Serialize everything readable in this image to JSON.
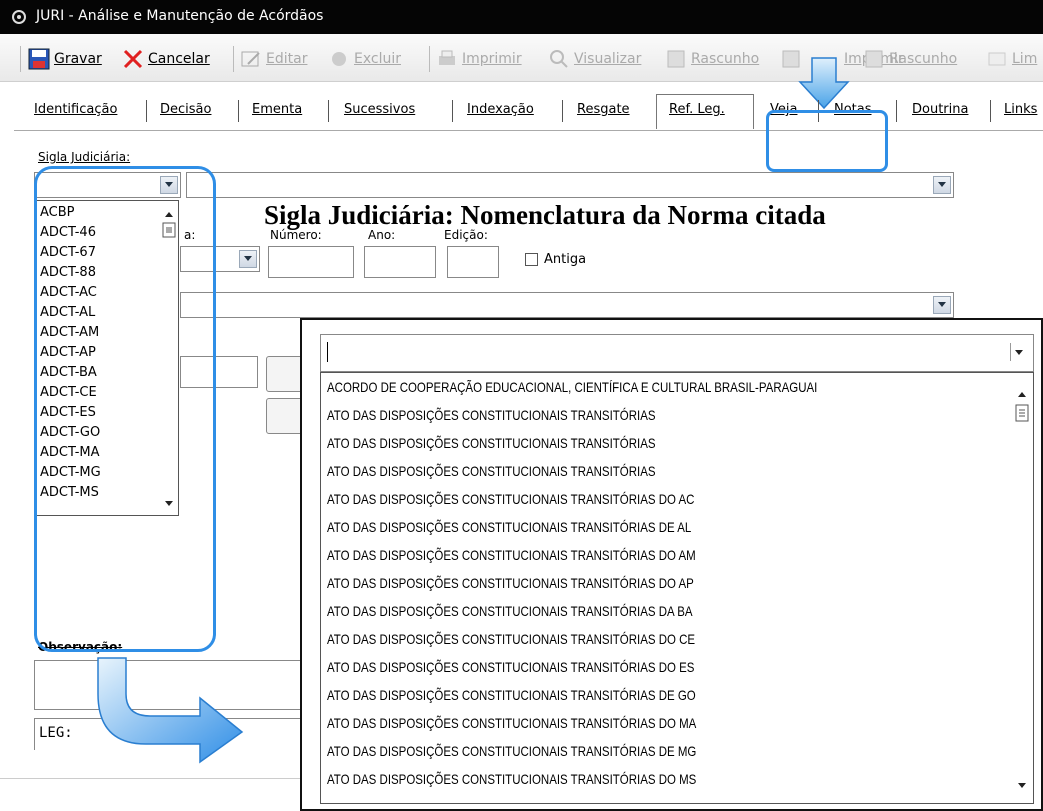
{
  "window": {
    "title": "JURI - Análise e Manutenção de Acórdãos"
  },
  "toolbar": {
    "gravar": "Gravar",
    "cancelar": "Cancelar",
    "editar": "Editar",
    "excluir": "Excluir",
    "imprimir": "Imprimir",
    "visualizar": "Visualizar",
    "rascunho1": "Rascunho",
    "imprimir_partial": "Imprimir",
    "rascunho2": "Rascunho",
    "limpar": "Lim"
  },
  "tabs": [
    "Identificação",
    "Decisão",
    "Ementa",
    "Sucessivos",
    "Indexação",
    "Resgate",
    "Ref. Leg.",
    "Veja",
    "Notas",
    "Doutrina",
    "Links"
  ],
  "form": {
    "sigla_label": "Sigla Judiciária:",
    "numero_label": "Número:",
    "ano_label": "Ano:",
    "edicao_label": "Edição:",
    "norma_label": "a:",
    "antiga_label": "Antiga",
    "observacao_label": "Observação:",
    "leg_text": "LEG:"
  },
  "sigla_list": [
    "ACBP",
    "ADCT-46",
    "ADCT-67",
    "ADCT-88",
    "ADCT-AC",
    "ADCT-AL",
    "ADCT-AM",
    "ADCT-AP",
    "ADCT-BA",
    "ADCT-CE",
    "ADCT-ES",
    "ADCT-GO",
    "ADCT-MA",
    "ADCT-MG",
    "ADCT-MS"
  ],
  "annotation": {
    "heading": "Sigla Judiciária: Nomenclatura da Norma citada"
  },
  "norma_list": [
    "ACORDO DE COOPERAÇÃO EDUCACIONAL, CIENTÍFICA E CULTURAL BRASIL-PARAGUAI",
    "ATO DAS DISPOSIÇÕES CONSTITUCIONAIS TRANSITÓRIAS",
    "ATO DAS DISPOSIÇÕES CONSTITUCIONAIS TRANSITÓRIAS",
    "ATO DAS DISPOSIÇÕES CONSTITUCIONAIS TRANSITÓRIAS",
    "ATO DAS DISPOSIÇÕES CONSTITUCIONAIS TRANSITÓRIAS DO AC",
    "ATO DAS DISPOSIÇÕES CONSTITUCIONAIS TRANSITÓRIAS DE AL",
    "ATO DAS DISPOSIÇÕES CONSTITUCIONAIS TRANSITÓRIAS DO AM",
    "ATO DAS DISPOSIÇÕES CONSTITUCIONAIS TRANSITÓRIAS DO AP",
    "ATO DAS DISPOSIÇÕES CONSTITUCIONAIS TRANSITÓRIAS DA BA",
    "ATO DAS DISPOSIÇÕES CONSTITUCIONAIS TRANSITÓRIAS DO CE",
    "ATO DAS DISPOSIÇÕES CONSTITUCIONAIS TRANSITÓRIAS DO ES",
    "ATO DAS DISPOSIÇÕES CONSTITUCIONAIS TRANSITÓRIAS DE GO",
    "ATO DAS DISPOSIÇÕES CONSTITUCIONAIS TRANSITÓRIAS DO MA",
    "ATO DAS DISPOSIÇÕES CONSTITUCIONAIS TRANSITÓRIAS DE MG",
    "ATO DAS DISPOSIÇÕES CONSTITUCIONAIS TRANSITÓRIAS DO MS"
  ],
  "colors": {
    "highlight": "#2f8ee6",
    "titlebar": "#050505"
  }
}
